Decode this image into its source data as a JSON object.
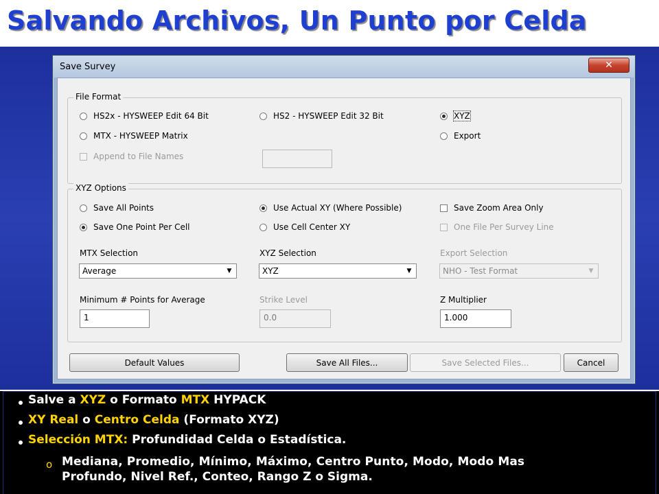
{
  "slide": {
    "title": "Salvando Archivos, Un Punto por Celda"
  },
  "dialog": {
    "title": "Save Survey",
    "close_glyph": "✕",
    "file_format": {
      "label": "File Format",
      "options": [
        {
          "label": "HS2x - HYSWEEP Edit 64 Bit",
          "selected": false
        },
        {
          "label": "HS2 - HYSWEEP Edit 32 Bit",
          "selected": false
        },
        {
          "label": "XYZ",
          "selected": true
        },
        {
          "label": "MTX - HYSWEEP Matrix",
          "selected": false
        },
        {
          "label": "Export",
          "selected": false
        }
      ],
      "append_label": "Append to File Names",
      "append_checked": false,
      "append_value": ""
    },
    "xyz_options": {
      "label": "XYZ Options",
      "save_all_points": "Save All Points",
      "save_one_point": "Save One Point Per Cell",
      "save_one_selected": true,
      "use_actual_xy": "Use Actual XY (Where Possible)",
      "use_actual_selected": true,
      "use_cell_center": "Use Cell Center XY",
      "save_zoom_area": "Save Zoom Area Only",
      "one_file_per_line": "One File Per Survey Line",
      "mtx_selection_label": "MTX Selection",
      "mtx_selection_value": "Average",
      "xyz_selection_label": "XYZ Selection",
      "xyz_selection_value": "XYZ",
      "export_selection_label": "Export Selection",
      "export_selection_value": "NHO - Test Format",
      "min_points_label": "Minimum # Points for Average",
      "min_points_value": "1",
      "strike_level_label": "Strike Level",
      "strike_level_value": "0.0",
      "z_multiplier_label": "Z Multiplier",
      "z_multiplier_value": "1.000"
    },
    "buttons": {
      "default_values": "Default Values",
      "save_all": "Save All Files...",
      "save_selected": "Save Selected Files...",
      "cancel": "Cancel"
    }
  },
  "bullets": {
    "b1": {
      "t1": "Salve a ",
      "t2": "XYZ",
      "t3": " o Formato ",
      "t4": "MTX",
      "t5": " HYPACK"
    },
    "b2": {
      "t1": "XY Real",
      "t2": " o ",
      "t3": "Centro Celda",
      "t4": " (Formato XYZ)"
    },
    "b3": {
      "t1": "Selección MTX:",
      "t2": " Profundidad Celda o Estadística."
    },
    "sub_marker": "o",
    "sub_line1": "Mediana, Promedio, Mínimo, Máximo, Centro Punto, Modo, Modo Mas",
    "sub_line2": "Profundo, Nivel Ref., Conteo, Rango Z o Sigma."
  },
  "colors": {
    "title_blue": "#1f3fd0",
    "background_blue": "#2a3fb2",
    "highlight_yellow": "#ffd200"
  }
}
